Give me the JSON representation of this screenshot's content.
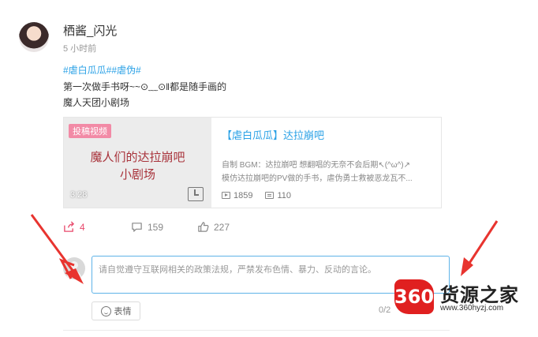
{
  "post": {
    "username": "栖酱_闪光",
    "time": "5 小时前",
    "tags": "#虐白瓜瓜##虐伪#",
    "line1": "第一次做手书呀~~⊙﹏⊙‖都是随手画的",
    "line2": "魔人天团小剧场"
  },
  "video_card": {
    "badge": "投稿视频",
    "cover_title_line1": "魔人们的达拉崩吧",
    "cover_title_line2": "小剧场",
    "duration": "3:28",
    "title": "【虐白瓜瓜】达拉崩吧",
    "desc_line1": "自制 BGM：达拉崩吧 想翻唱的无奈不会后期↖(^ω^)↗",
    "desc_line2": "模仿达拉崩吧的PV做的手书，虐伪勇士救被恶龙瓦不...",
    "plays": "1859",
    "danmaku": "110",
    "icons": [
      "play-icon",
      "danmaku-icon",
      "clock-icon"
    ]
  },
  "actions": {
    "share_count": "4",
    "comment_count": "159",
    "like_count": "227",
    "icons": [
      "share-icon",
      "comment-icon",
      "like-icon"
    ],
    "share_color": "#e8486b"
  },
  "comment": {
    "placeholder": "请自觉遵守互联网相关的政策法规，严禁发布色情、暴力、反动的言论。",
    "emoji_label": "表情",
    "counter": "0/2"
  },
  "watermark": {
    "logo": "360",
    "text": "货源之家",
    "url": "www.360hyzj.com"
  },
  "colors": {
    "link": "#2aa1e6",
    "annotation_arrow": "#e8342f",
    "input_border": "#5fb3e8"
  }
}
